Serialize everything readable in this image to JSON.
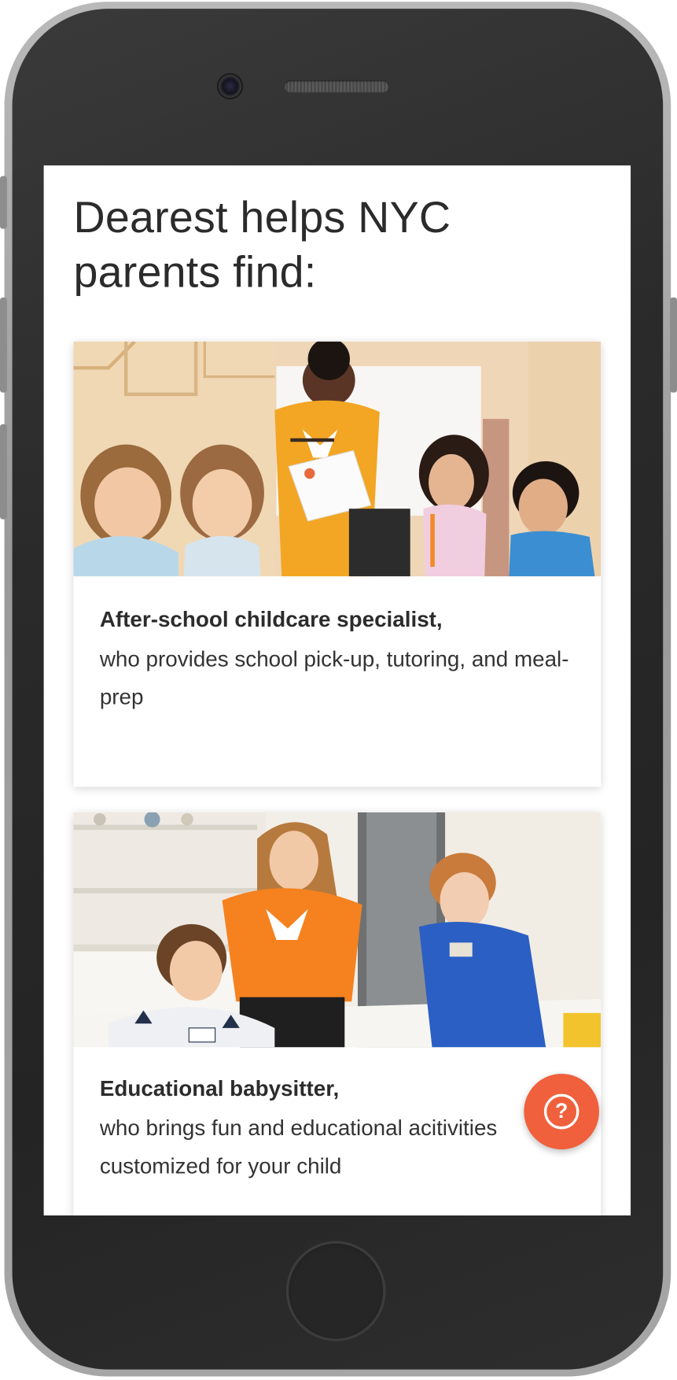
{
  "page": {
    "headline": "Dearest helps NYC parents find:"
  },
  "cards": [
    {
      "title": "After-school childcare specialist,",
      "description": "who provides school pick-up, tutoring, and meal-prep",
      "photo_icon": "children-drawing-photo"
    },
    {
      "title": "Educational babysitter,",
      "description": "who brings fun and educational acitivities customized for your child",
      "photo_icon": "children-activity-photo"
    }
  ],
  "help_button": {
    "icon": "question-mark-icon",
    "glyph": "?",
    "color": "#f0603c"
  },
  "colors": {
    "phone_body": "#2a2a2a",
    "heading_text": "#2b2b2b",
    "accent": "#f0603c",
    "shirt_orange": "#f39a2a"
  }
}
